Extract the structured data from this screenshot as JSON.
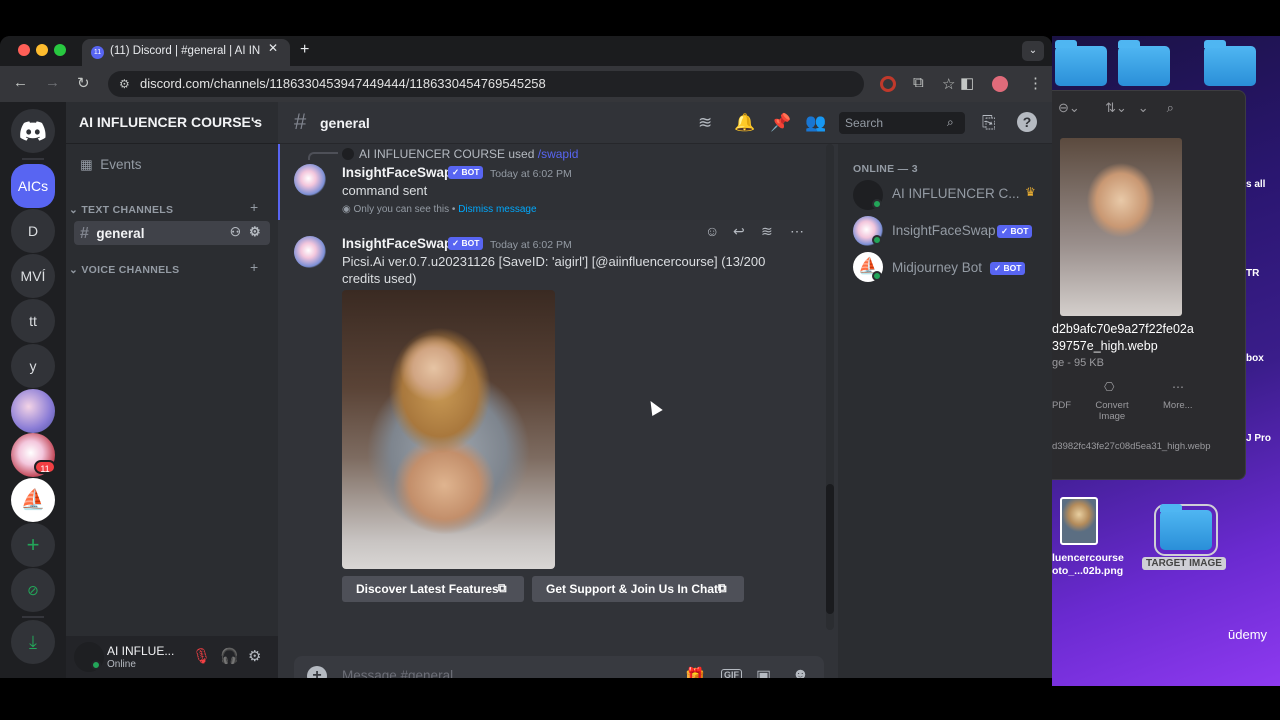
{
  "browser": {
    "tab_title": "(11) Discord | #general | AI IN",
    "tab_badge": "11",
    "url": "discord.com/channels/1186330453947449444/1186330454769545258"
  },
  "servers": {
    "badge": "11",
    "items": [
      "AICs",
      "D",
      "MVÍ",
      "tt",
      "y"
    ]
  },
  "guild": {
    "name": "AI INFLUENCER COURSE's",
    "events_label": "Events",
    "text_channels_label": "TEXT CHANNELS",
    "voice_channels_label": "VOICE CHANNELS",
    "channels": [
      {
        "name": "general"
      }
    ]
  },
  "user": {
    "name": "AI INFLUE...",
    "status": "Online"
  },
  "header": {
    "channel": "general",
    "search_placeholder": "Search"
  },
  "messages": [
    {
      "reply": {
        "user": "AI INFLUENCER COURSE used",
        "command": "/swapid"
      },
      "author": "InsightFaceSwap",
      "badge": "BOT",
      "time": "Today at 6:02 PM",
      "text": "command sent",
      "ephemeral_note": "Only you can see this • ",
      "dismiss": "Dismiss message"
    },
    {
      "author": "InsightFaceSwap",
      "badge": "BOT",
      "time": "Today at 6:02 PM",
      "text_line1": "Picsi.Ai ver.0.7.u20231126 [SaveID: 'aigirl'] [@aiinfluencercourse] (13/200",
      "text_line2": "credits used)",
      "buttons": [
        "Discover Latest Features",
        "Get Support & Join Us In Chat!"
      ]
    }
  ],
  "composer": {
    "placeholder": "Message #general"
  },
  "members": {
    "header": "ONLINE — 3",
    "list": [
      {
        "name": "AI INFLUENCER C...",
        "bot": false
      },
      {
        "name": "InsightFaceSwap",
        "bot": true,
        "badge": "BOT"
      },
      {
        "name": "Midjourney Bot",
        "bot": true,
        "badge": "BOT"
      }
    ]
  },
  "desktop": {
    "file_name_line1": "d2b9afc70e9a27f22fe02a",
    "file_name_line2": "39757e_high.webp",
    "file_meta": "ge - 95 KB",
    "actions": [
      "PDF",
      "Convert Image",
      "More..."
    ],
    "path_text": "d3982fc43fe27c08d5ea31_high.webp",
    "side_labels": [
      "s all",
      "TR",
      "box",
      "J Pro"
    ],
    "thumb_label_line1": "luencercourse",
    "thumb_label_line2": "oto_...02b.png",
    "folder_label": "TARGET IMAGE",
    "watermark": "ūdemy"
  },
  "colors": {
    "blurple": "#5865f2",
    "online": "#23a559",
    "background": "#313338"
  }
}
